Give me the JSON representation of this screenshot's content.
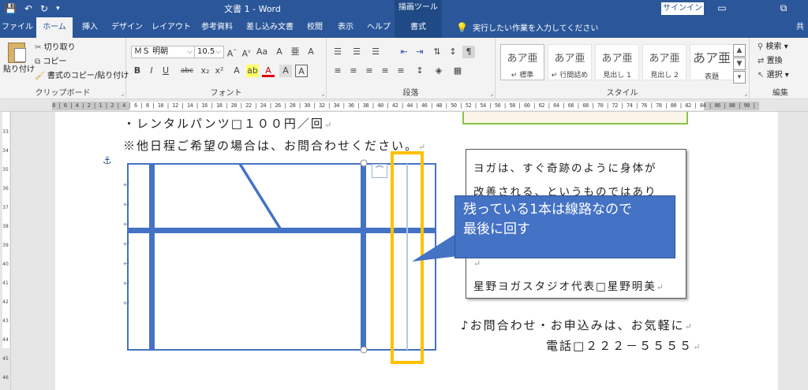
{
  "window": {
    "doc_title": "文書 1  -  Word",
    "contextual_tab": "描画ツール",
    "signin": "サインイン",
    "qat": [
      "💾",
      "↶",
      "↻",
      "▾"
    ],
    "win_controls": [
      "▭",
      "⧉"
    ]
  },
  "tabs": [
    "ファイル",
    "ホーム",
    "挿入",
    "デザイン",
    "レイアウト",
    "参考資料",
    "差し込み文書",
    "校閲",
    "表示",
    "ヘルプ",
    "書式"
  ],
  "tellme": "実行したい作業を入力してください",
  "user_initial": "共",
  "clipboard": {
    "label": "クリップボード",
    "paste": "貼り付け",
    "cut": "切り取り",
    "copy": "コピー",
    "format_painter": "書式のコピー/貼り付け"
  },
  "font": {
    "label": "フォント",
    "font_name": "ＭＳ 明朝",
    "font_size": "10.5",
    "buttons": [
      "B",
      "I",
      "U",
      "abc",
      "x₂",
      "x²",
      "A",
      "A"
    ]
  },
  "paragraph": {
    "label": "段落"
  },
  "styles": {
    "label": "スタイル",
    "tiles": [
      {
        "sample": "あア亜",
        "name": "↵ 標準"
      },
      {
        "sample": "あア亜",
        "name": "↵ 行間詰め"
      },
      {
        "sample": "あア亜",
        "name": "見出し 1"
      },
      {
        "sample": "あア亜",
        "name": "見出し 2"
      },
      {
        "sample": "あア亜",
        "name": "表題"
      }
    ]
  },
  "editing": {
    "label": "編集",
    "find": "検索",
    "replace": "置換",
    "select": "選択"
  },
  "ruler": {
    "numbers": "8 | 6 | 4 | 2 | 1 | 2 | 4 | 6 | 8 | 10 | 12 | 14 | 16 | 18 | 20 | 22 | 24 | 26 | 28 | 30 | 32 | 34 | 36 | 38 | 40 | 42 | 44 | 46 | 48 | 50 | 52 | 54 | 56 | 58 | 60 | 62 | 64 | 66 | 68 | 70 | 72 | 74 | 76 | 78 | 80 | 82 | 84 | 86 | 88 | 90 | 92 | 94 | 96 | 98 | 100",
    "vertical": [
      "33",
      "34",
      "35",
      "36",
      "37",
      "38",
      "39",
      "40",
      "41",
      "42",
      "43",
      "44",
      "45",
      "46"
    ]
  },
  "document": {
    "line1": "・レンタルパンツ□１００円／回",
    "line2": "※他日程ご希望の場合は、お問合わせください。",
    "contact_line": "♪お問合わせ・お申込みは、お気軽に",
    "phone_line": "電話□２２２－５５５５",
    "para_mark": "↵"
  },
  "textbox": {
    "lines": [
      "ヨガは、すぐ奇跡のように身体が",
      "改善される、というものではあり",
      "星野ヨガスタジオ代表□星野明美"
    ],
    "para_mark": "↵"
  },
  "callout": {
    "line1": "残っている1本は線路なので",
    "line2": "最後に回す"
  },
  "colors": {
    "word_blue": "#2b579a",
    "shape_blue": "#4472c4",
    "highlight_yellow": "#ffc000",
    "callout_fill": "#4472c4"
  }
}
